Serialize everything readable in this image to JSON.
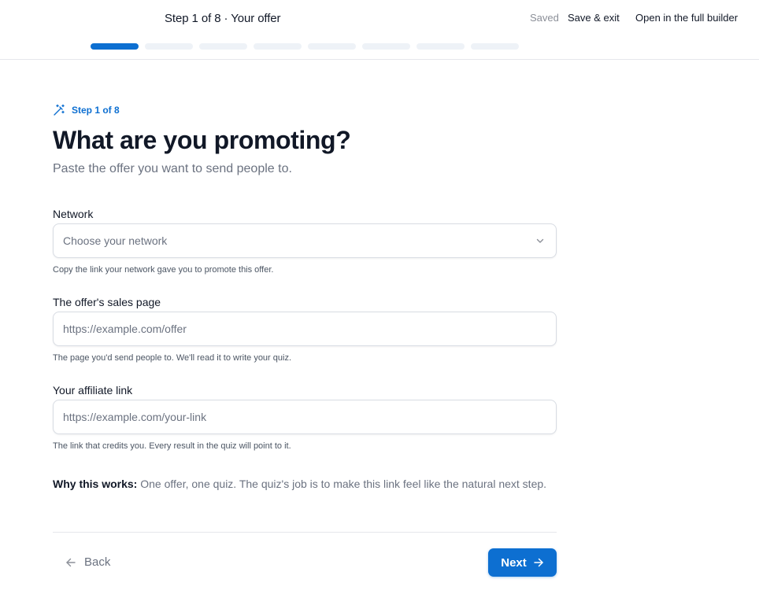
{
  "header": {
    "step_title": "Step 1 of 8 · Your offer",
    "saved_label": "Saved",
    "save_exit_label": "Save & exit",
    "full_builder_label": "Open in the full builder",
    "progress": {
      "total_steps": 8,
      "current_step": 1
    }
  },
  "eyebrow": {
    "icon": "magic-wand-icon",
    "text": "Step 1 of 8"
  },
  "title": "What are you promoting?",
  "subtitle": "Paste the offer you want to send people to.",
  "fields": {
    "network": {
      "label": "Network",
      "placeholder": "Choose your network",
      "help": "Copy the link your network gave you to promote this offer."
    },
    "sales_page": {
      "label": "The offer's sales page",
      "placeholder": "https://example.com/offer",
      "value": "",
      "help": "The page you'd send people to. We'll read it to write your quiz."
    },
    "affiliate_link": {
      "label": "Your affiliate link",
      "placeholder": "https://example.com/your-link",
      "value": "",
      "help": "The link that credits you. Every result in the quiz will point to it."
    }
  },
  "why": {
    "lead": "Why this works:",
    "text": " One offer, one quiz. The quiz's job is to make this link feel like the natural next step."
  },
  "footer": {
    "back_label": "Back",
    "next_label": "Next"
  },
  "colors": {
    "accent": "#0d6fd1",
    "progress_track": "#eef2f7",
    "muted_text": "#6b7280"
  }
}
